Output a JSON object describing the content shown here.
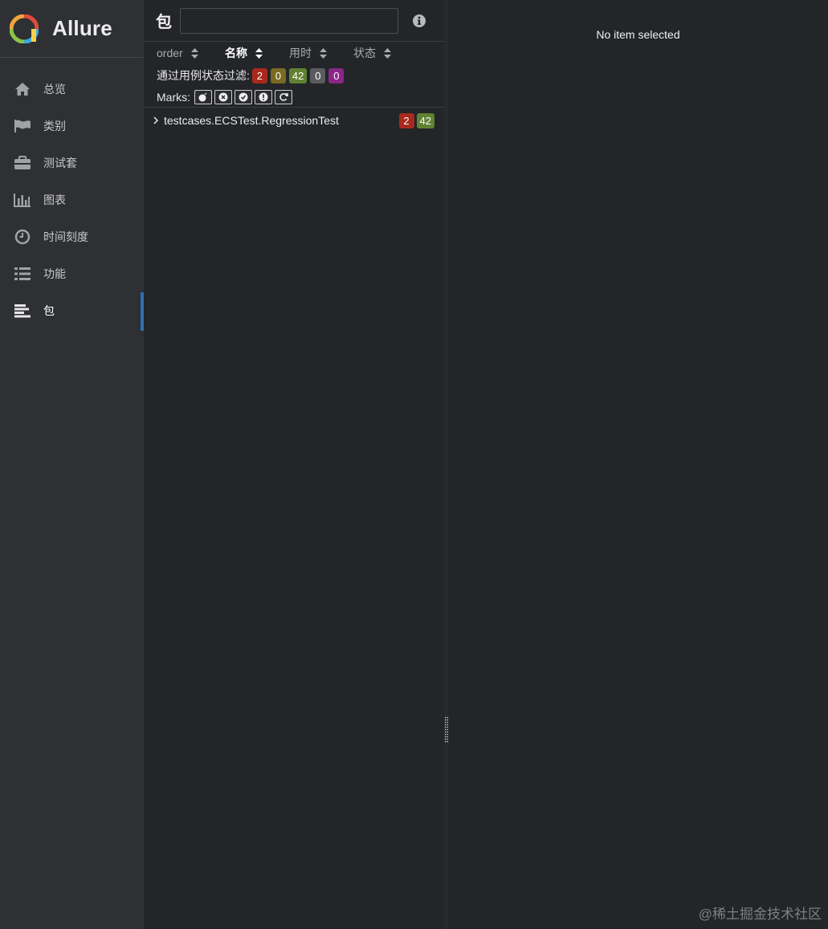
{
  "brand": {
    "name": "Allure"
  },
  "sidebar": {
    "items": [
      {
        "label": "总览",
        "icon": "home-icon"
      },
      {
        "label": "类别",
        "icon": "flag-icon"
      },
      {
        "label": "测试套",
        "icon": "briefcase-icon"
      },
      {
        "label": "图表",
        "icon": "bar-chart-icon"
      },
      {
        "label": "时间刻度",
        "icon": "clock-icon"
      },
      {
        "label": "功能",
        "icon": "list-icon"
      },
      {
        "label": "包",
        "icon": "align-left-icon",
        "active": true
      }
    ]
  },
  "tree": {
    "title": "包",
    "search": {
      "value": "",
      "placeholder": ""
    },
    "sorters": [
      {
        "label": "order",
        "active": false
      },
      {
        "label": "名称",
        "active": true
      },
      {
        "label": "用时",
        "active": false
      },
      {
        "label": "状态",
        "active": false
      }
    ],
    "filter": {
      "label": "通过用例状态过滤:",
      "badges": [
        {
          "value": "2",
          "status": "failed",
          "color": "#a8291d"
        },
        {
          "value": "0",
          "status": "broken",
          "color": "#7a6a22"
        },
        {
          "value": "42",
          "status": "passed",
          "color": "#5f8231"
        },
        {
          "value": "0",
          "status": "skipped",
          "color": "#5a5d60"
        },
        {
          "value": "0",
          "status": "unknown",
          "color": "#8a2786"
        }
      ]
    },
    "marks": {
      "label": "Marks:",
      "items": [
        "flaky-bomb-icon",
        "new-failed-icon",
        "new-passed-icon",
        "new-broken-icon",
        "retries-icon"
      ]
    },
    "rows": [
      {
        "name": "testcases.ECSTest.RegressionTest",
        "failed": "2",
        "passed": "42"
      }
    ]
  },
  "detail": {
    "empty_text": "No item selected"
  },
  "watermark": "@稀土掘金技术社区"
}
